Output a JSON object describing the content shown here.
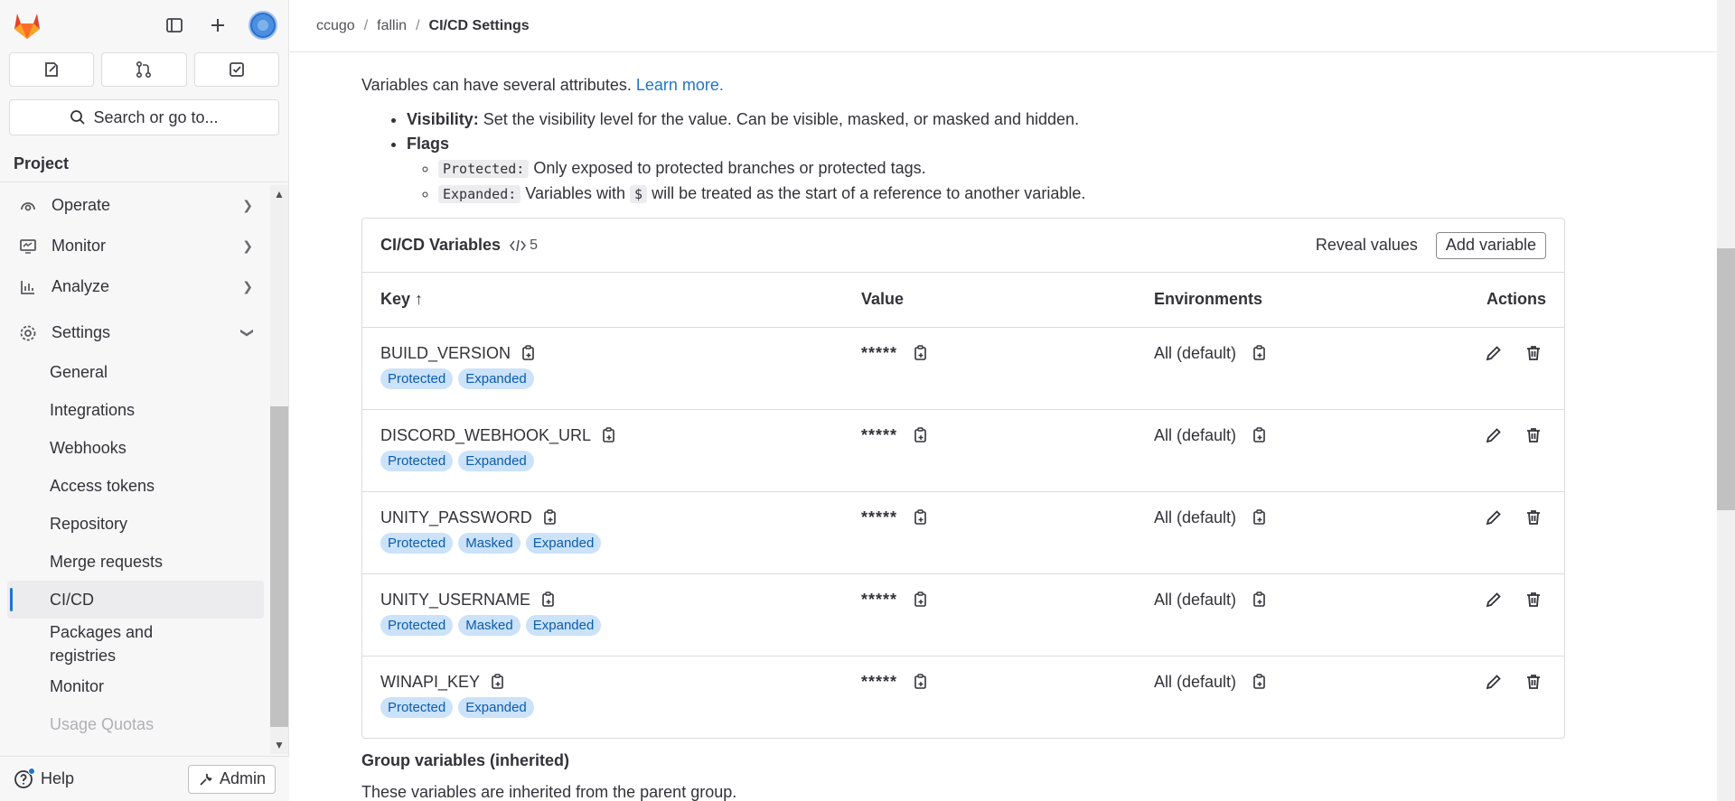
{
  "sidebar": {
    "search_label": "Search or go to...",
    "section_title": "Project",
    "nav": [
      {
        "label": "Operate"
      },
      {
        "label": "Monitor"
      },
      {
        "label": "Analyze"
      },
      {
        "label": "Settings"
      }
    ],
    "settings_items": [
      "General",
      "Integrations",
      "Webhooks",
      "Access tokens",
      "Repository",
      "Merge requests",
      "CI/CD",
      "Packages and registries",
      "Monitor",
      "Usage Quotas"
    ],
    "active_item": "CI/CD",
    "help_label": "Help",
    "admin_label": "Admin"
  },
  "breadcrumb": {
    "items": [
      "ccugo",
      "fallin"
    ],
    "current": "CI/CD Settings"
  },
  "intro": {
    "text": "Variables can have several attributes.",
    "link": "Learn more.",
    "visibility_label": "Visibility:",
    "visibility_text": "Set the visibility level for the value. Can be visible, masked, or masked and hidden.",
    "flags_label": "Flags",
    "protected_code": "Protected:",
    "protected_text": "Only exposed to protected branches or protected tags.",
    "expanded_code": "Expanded:",
    "expanded_text_1": "Variables with",
    "expanded_code_dollar": "$",
    "expanded_text_2": "will be treated as the start of a reference to another variable."
  },
  "variables": {
    "title": "CI/CD Variables",
    "count": "5",
    "reveal_label": "Reveal values",
    "add_label": "Add variable",
    "headers": {
      "key": "Key",
      "value": "Value",
      "environments": "Environments",
      "actions": "Actions"
    },
    "rows": [
      {
        "key": "BUILD_VERSION",
        "badges": [
          "Protected",
          "Expanded"
        ],
        "value": "*****",
        "env": "All (default)"
      },
      {
        "key": "DISCORD_WEBHOOK_URL",
        "badges": [
          "Protected",
          "Expanded"
        ],
        "value": "*****",
        "env": "All (default)"
      },
      {
        "key": "UNITY_PASSWORD",
        "badges": [
          "Protected",
          "Masked",
          "Expanded"
        ],
        "value": "*****",
        "env": "All (default)"
      },
      {
        "key": "UNITY_USERNAME",
        "badges": [
          "Protected",
          "Masked",
          "Expanded"
        ],
        "value": "*****",
        "env": "All (default)"
      },
      {
        "key": "WINAPI_KEY",
        "badges": [
          "Protected",
          "Expanded"
        ],
        "value": "*****",
        "env": "All (default)"
      }
    ]
  },
  "group": {
    "title": "Group variables (inherited)",
    "desc": "These variables are inherited from the parent group."
  },
  "colors": {
    "accent": "#1f75cb",
    "badge_bg": "#cbe2f9",
    "badge_text": "#0b5cad",
    "logo": "#e24329"
  }
}
